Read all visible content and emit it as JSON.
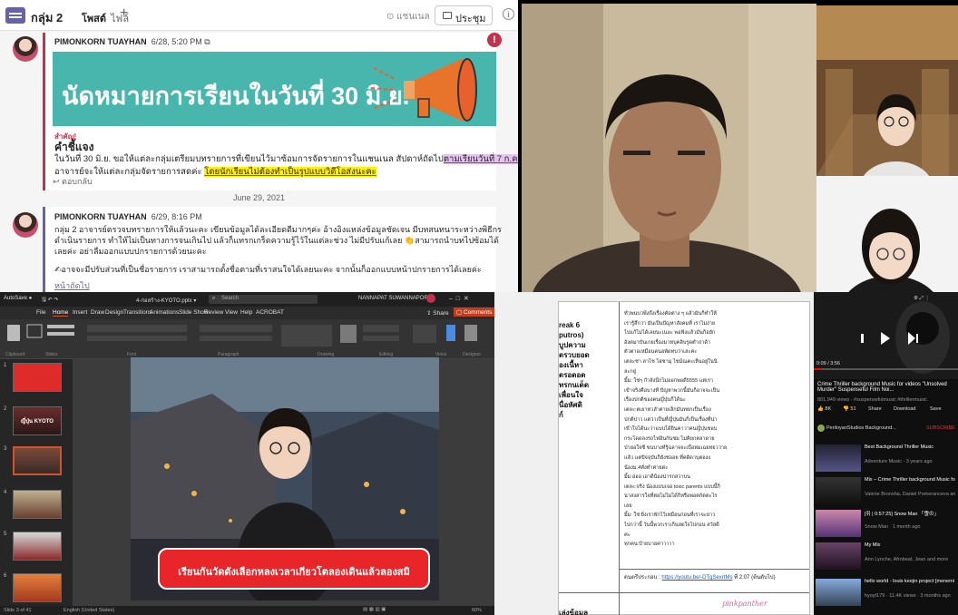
{
  "teams": {
    "channel_title": "กลุ่ม 2",
    "tabs": [
      {
        "label": "โพสต์",
        "active": true
      },
      {
        "label": "ไฟล์",
        "active": false
      }
    ],
    "channel_button": "แชนเนล",
    "meet_button": "ประชุม",
    "posts": [
      {
        "author": "PIMONKORN TUAYHAN",
        "time": "6/28, 5:20 PM",
        "banner_text": "นัดหมายการเรียนในวันที่ 30 มิ.ย.",
        "important_label": "สำคัญ!",
        "heading": "คำชี้แจง",
        "line1_a": "ในวันที่ 30 มิ.ย. ขอให้แต่ละกลุ่มเตรียมบทรายการที่เขียนไว้มาซ้อมการจัดรายการในแชนเนล สัปดาห์ถัดไป",
        "line1_b": "ตามเรียนวันที่ 7 ก.ค.",
        "line2_a": "อาจารย์จะให้แต่ละกลุ่มจัดรายการสดค่ะ ",
        "line2_b": "โดยนักเรียนไม่ต้องทำเป็นรูปแบบวิดีโอส่งนะคะ",
        "reply": "ตอบกลับ"
      },
      {
        "author": "PIMONKORN TUAYHAN",
        "time": "6/29, 8:16 PM",
        "lines": [
          "กลุ่ม 2 อาจารย์ตรวจบทรายการให้แล้วนะคะ เขียนข้อมูลได้ละเอียดดีมากๆค่ะ อ้างอิงแหล่งข้อมูลชัดเจน มีบทสนทนาระหว่างพิธีกร",
          "ดำเนินรายการ ทำให้ไม่เป็นทางการจนเกินไป แล้วก็แทรกเกร็ดความรู้ไว้ในแต่ละช่วง ไม่มีปรับแก้เลย 👏สามารถนำบทไปซ้อมได้",
          "เลยค่ะ อย่าลืมออกแบบปกรายการด้วยนะคะ",
          "✍อาจจะมีปรับส่วนที่เป็นชื่อรายการ เราสามารถตั้งชื่อตามที่เราสนใจได้เลยนะคะ จากนั้นก็ออกแบบหน้าปกรายการได้เลยค่ะ"
        ],
        "more": "หน้าถัดไป"
      }
    ],
    "date_separator": "June 29, 2021"
  },
  "ppt": {
    "file_name": "4-ก่อสร้าง-KYOTO.pptx ▾",
    "search_placeholder": "Search",
    "user_name": "NANNAPAT SUWANNAPORN",
    "menu": [
      "File",
      "Home",
      "Insert",
      "Draw",
      "Design",
      "Transitions",
      "Animations",
      "Slide Show",
      "Review",
      "View",
      "Help",
      "ACROBAT"
    ],
    "share": "Share",
    "comments": "Comments",
    "thumb2_text": "ญี่ปุ่น KYOTO",
    "slide_banner": "เรียนกันวัดดังเลือกหลงเวลาเกียวโตลองเดินแล้วลองสมิ",
    "status_left": "Slide 3 of 41",
    "status_lang": "English (United States)",
    "zoom": "60%"
  },
  "doc": {
    "left_fragments": [
      "reak 6",
      "putros)",
      "บูปความ",
      "ตรวบยอด",
      "องเนื้หา",
      "ตรอดอด",
      "ทรกนเด็ด",
      "เพื่อนใจ",
      "นื่อหัศดิ",
      "ก์"
    ],
    "lines": [
      "ทั่วพนบวพึงถึงเรื่องคัดต่าง ๆ แล้วมันก็ทำให้",
      "เรารู้สึกว่า มันเป็นปัญหาสังคมที่ เราไม่ง่าย",
      "ไปแก้ไม่ได้เลยนะเนอะ พอฟังแล้วมันก็อยัก",
      "อังคมาบันเกยเรื่องมาทบุคลิบรูดตําถ่าด้า",
      "ตัวตาอเหมือนคนอพัดทบว่าเล่ะค่ะ",
      "เตละช่า ลาโช โฮชามุ ไชม์ณคะเห็นอยู่ในนิ",
      "ละกยู่",
      "มิ้ม: ใช่ๆ กำลังนึกไม่ออกพอดี5555 แต่เรา",
      "เข้าจริงคือบางที ปัญหาพวกนี้มันก็อาจจะเป็น",
      "เรื่องปกติของคนญี่ปุ่นก็ได้นะ",
      "เตละ:ตเยาทวลำต่ายเล็กมันทยกเป็นเรื่อง",
      "ปกติปาว แต่ว่าเป็นที่ญี่ปุ่นมันก็เป็นเรื่องที่น่า",
      "เข้าใจได้นะว่าแบบได้ยินคาวาคนญี่ปุ่นชอบ",
      "กระโดดลงรถไฟอินกันชม ไม่คิยกตลาดาย",
      "ป่ายอใจซี ขนบางท์รู้ฉลาจจะเบื่อหมเฉยทยวว่าย",
      "แล้ว แต่ปัจจุบันก็ยังช่ออย ที่คดิดาบุตองง",
      "น้องม.4ทั่งทำค่ายด่ะ",
      "มิ้ม:อ่ออ เอาดีน้องน่ารกสวาบน",
      "เตละ:จริง น้องแบบเจอ toxic parents แบบนี้ก็",
      "น่าสงสารใจที่ต่อไม่ไม่ได้ก็หรือพ่อตกัตตะไร",
      "เลย",
      "มิ้ม: ใช่ ยิ่งเราพักไว้เหมือนก่อนที่เราจะยาว",
      "ไปกว่านี้ วันนี้พวกเราเกีนสดใจไปก่อน สวัสดี",
      "ค่ะ",
      "ทุกคน:บ้ายบายค่าาาาา"
    ],
    "ref_label": "ดนตรีประกอบ : ",
    "ref_link": "https://youtu.be/-DTgSexrtMs",
    "ref_time": " ที่ 2:07 (ต้นดับไป)",
    "handwriting": "pinkpanther",
    "bottom_label": "เล่งข้อมูล"
  },
  "youtube": {
    "video_title": "Crime Thriller background Music for videos \"Unsolved Murder\" Suspenseful Film Noi...",
    "views": "801,949 views · #suspensefulmusic #thrillermusic",
    "actions": [
      "8K",
      "51",
      "Share",
      "Download",
      "Save"
    ],
    "channel": "PeriloyanStudios Background...",
    "subscribe": "SUBSCRIBE",
    "time": "0:09 / 3:56",
    "recs": [
      {
        "title": "Best Background Thriller Music",
        "meta": "Adventure Music · 3 years ago"
      },
      {
        "title": "Mix – Crime Thriller background Music for videos \"Unsolv...",
        "meta": "Valerie Bronsha, Daniel Pomeranceva and more"
      },
      {
        "title": "[쥐 | 0:57:25] Snow Man 「雪の」",
        "meta": "Snow Man · 1 month ago"
      },
      {
        "title": "My Mix",
        "meta": "Ann Lynche, Afrobeat, Jean and more"
      },
      {
        "title": "hello world - louis keejin project [menemi version] ",
        "meta": "hyoyt179 · 11.4K views · 3 months ago"
      }
    ]
  }
}
